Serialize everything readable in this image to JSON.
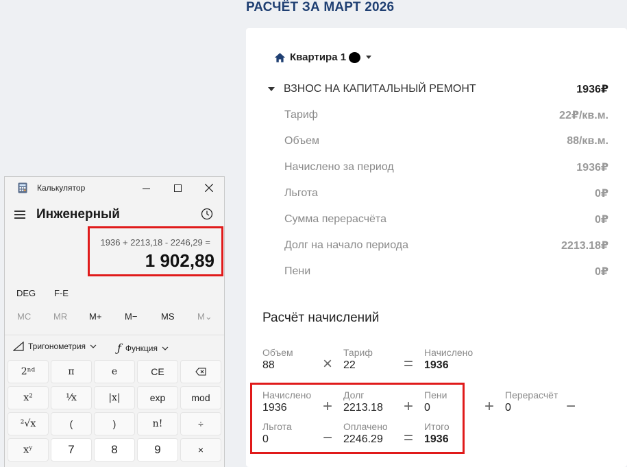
{
  "page": {
    "heading": "РАСЧЁТ ЗА МАРТ 2026"
  },
  "apartment": {
    "label": "Квартира 1",
    "icon": "home-icon"
  },
  "service": {
    "name": "ВЗНОС НА КАПИТАЛЬНЫЙ РЕМОНТ",
    "sum": "1936₽"
  },
  "details": [
    {
      "label": "Тариф",
      "value": "22₽/кв.м."
    },
    {
      "label": "Объем",
      "value": "88/кв.м."
    },
    {
      "label": "Начислено за период",
      "value": "1936₽"
    },
    {
      "label": "Льгота",
      "value": "0₽"
    },
    {
      "label": "Сумма перерасчёта",
      "value": "0₽"
    },
    {
      "label": "Долг на начало периода",
      "value": "2213.18₽"
    },
    {
      "label": "Пени",
      "value": "0₽"
    }
  ],
  "calc_section": {
    "title": "Расчёт начислений",
    "row1": {
      "a": {
        "label": "Объем",
        "value": "88"
      },
      "op1": "×",
      "b": {
        "label": "Тариф",
        "value": "22"
      },
      "op2": "=",
      "c": {
        "label": "Начислено",
        "value": "1936"
      }
    },
    "row2": {
      "a": {
        "label": "Начислено",
        "value": "1936"
      },
      "op1": "+",
      "b": {
        "label": "Долг",
        "value": "2213.18"
      },
      "op2": "+",
      "c": {
        "label": "Пени",
        "value": "0"
      },
      "op3": "+",
      "d": {
        "label": "Перерасчёт",
        "value": "0"
      },
      "op4": "−"
    },
    "row3": {
      "a": {
        "label": "Льгота",
        "value": "0"
      },
      "op1": "−",
      "b": {
        "label": "Оплачено",
        "value": "2246.29"
      },
      "op2": "=",
      "c": {
        "label": "Итого",
        "value": "1936"
      }
    }
  },
  "calculator": {
    "title": "Калькулятор",
    "mode": "Инженерный",
    "expression": "1936 + 2213,18 - 2246,29 =",
    "result": "1 902,89",
    "angle": "DEG",
    "fe": "F-E",
    "memory": [
      "MC",
      "MR",
      "M+",
      "M−",
      "MS",
      "M⌄"
    ],
    "menus": {
      "trig": "Тригонометрия",
      "func": "Функция"
    },
    "keys": [
      [
        "2ⁿᵈ",
        "π",
        "e",
        "CE",
        "⌫"
      ],
      [
        "x²",
        "¹⁄x",
        "|x|",
        "exp",
        "mod"
      ],
      [
        "²√x",
        "(",
        ")",
        "n!",
        "÷"
      ],
      [
        "xʸ",
        "7",
        "8",
        "9",
        "×"
      ]
    ]
  },
  "colors": {
    "highlight": "#e01a1a",
    "heading": "#1f3f72"
  }
}
